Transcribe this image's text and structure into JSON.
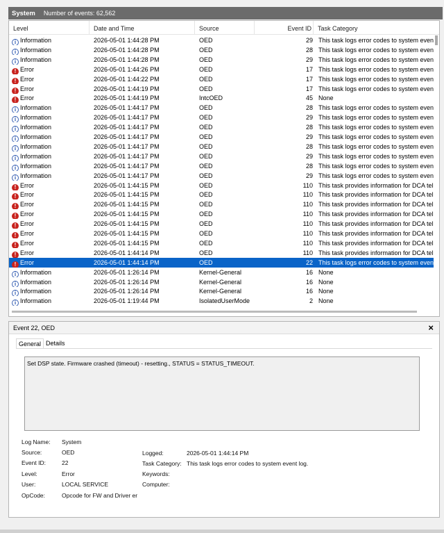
{
  "title_bar": {
    "log_name": "System",
    "event_count": "Number of events: 62,562"
  },
  "columns": {
    "level": "Level",
    "date": "Date and Time",
    "source": "Source",
    "event_id": "Event ID",
    "category": "Task Category"
  },
  "events": [
    {
      "level": "Information",
      "date": "2026-05-01 1:44:28 PM",
      "source": "OED",
      "id": "29",
      "category": "This task logs error codes to system event"
    },
    {
      "level": "Information",
      "date": "2026-05-01 1:44:28 PM",
      "source": "OED",
      "id": "28",
      "category": "This task logs error codes to system event"
    },
    {
      "level": "Information",
      "date": "2026-05-01 1:44:28 PM",
      "source": "OED",
      "id": "29",
      "category": "This task logs error codes to system event"
    },
    {
      "level": "Error",
      "date": "2026-05-01 1:44:26 PM",
      "source": "OED",
      "id": "17",
      "category": "This task logs error codes to system event"
    },
    {
      "level": "Error",
      "date": "2026-05-01 1:44:22 PM",
      "source": "OED",
      "id": "17",
      "category": "This task logs error codes to system event"
    },
    {
      "level": "Error",
      "date": "2026-05-01 1:44:19 PM",
      "source": "OED",
      "id": "17",
      "category": "This task logs error codes to system event"
    },
    {
      "level": "Error",
      "date": "2026-05-01 1:44:19 PM",
      "source": "IntcOED",
      "id": "45",
      "category": "None"
    },
    {
      "level": "Information",
      "date": "2026-05-01 1:44:17 PM",
      "source": "OED",
      "id": "28",
      "category": "This task logs error codes to system event"
    },
    {
      "level": "Information",
      "date": "2026-05-01 1:44:17 PM",
      "source": "OED",
      "id": "29",
      "category": "This task logs error codes to system event"
    },
    {
      "level": "Information",
      "date": "2026-05-01 1:44:17 PM",
      "source": "OED",
      "id": "28",
      "category": "This task logs error codes to system event"
    },
    {
      "level": "Information",
      "date": "2026-05-01 1:44:17 PM",
      "source": "OED",
      "id": "29",
      "category": "This task logs error codes to system event"
    },
    {
      "level": "Information",
      "date": "2026-05-01 1:44:17 PM",
      "source": "OED",
      "id": "28",
      "category": "This task logs error codes to system event"
    },
    {
      "level": "Information",
      "date": "2026-05-01 1:44:17 PM",
      "source": "OED",
      "id": "29",
      "category": "This task logs error codes to system event"
    },
    {
      "level": "Information",
      "date": "2026-05-01 1:44:17 PM",
      "source": "OED",
      "id": "28",
      "category": "This task logs error codes to system event"
    },
    {
      "level": "Information",
      "date": "2026-05-01 1:44:17 PM",
      "source": "OED",
      "id": "29",
      "category": "This task logs error codes to system event"
    },
    {
      "level": "Error",
      "date": "2026-05-01 1:44:15 PM",
      "source": "OED",
      "id": "110",
      "category": "This task provides information for DCA tel"
    },
    {
      "level": "Error",
      "date": "2026-05-01 1:44:15 PM",
      "source": "OED",
      "id": "110",
      "category": "This task provides information for DCA tel"
    },
    {
      "level": "Error",
      "date": "2026-05-01 1:44:15 PM",
      "source": "OED",
      "id": "110",
      "category": "This task provides information for DCA tel"
    },
    {
      "level": "Error",
      "date": "2026-05-01 1:44:15 PM",
      "source": "OED",
      "id": "110",
      "category": "This task provides information for DCA tel"
    },
    {
      "level": "Error",
      "date": "2026-05-01 1:44:15 PM",
      "source": "OED",
      "id": "110",
      "category": "This task provides information for DCA tel"
    },
    {
      "level": "Error",
      "date": "2026-05-01 1:44:15 PM",
      "source": "OED",
      "id": "110",
      "category": "This task provides information for DCA tel"
    },
    {
      "level": "Error",
      "date": "2026-05-01 1:44:15 PM",
      "source": "OED",
      "id": "110",
      "category": "This task provides information for DCA tel"
    },
    {
      "level": "Error",
      "date": "2026-05-01 1:44:14 PM",
      "source": "OED",
      "id": "110",
      "category": "This task provides information for DCA tel"
    },
    {
      "level": "Error",
      "date": "2026-05-01 1:44:14 PM",
      "source": "OED",
      "id": "22",
      "category": "This task logs error codes to system event",
      "selected": true
    },
    {
      "level": "Information",
      "date": "2026-05-01 1:26:14 PM",
      "source": "Kernel-General",
      "id": "16",
      "category": "None"
    },
    {
      "level": "Information",
      "date": "2026-05-01 1:26:14 PM",
      "source": "Kernel-General",
      "id": "16",
      "category": "None"
    },
    {
      "level": "Information",
      "date": "2026-05-01 1:26:14 PM",
      "source": "Kernel-General",
      "id": "16",
      "category": "None"
    },
    {
      "level": "Information",
      "date": "2026-05-01 1:19:44 PM",
      "source": "IsolatedUserMode",
      "id": "2",
      "category": "None"
    }
  ],
  "detail": {
    "title": "Event 22, OED",
    "close": "×",
    "tabs": [
      "General",
      "Details"
    ],
    "message": "Set DSP state. Firmware crashed (timeout) - resetting., STATUS = STATUS_TIMEOUT.",
    "labels": {
      "log_name": "Log Name:",
      "source": "Source:",
      "event_id": "Event ID:",
      "level": "Level:",
      "user": "User:",
      "opcode": "OpCode:",
      "logged": "Logged:",
      "task_category": "Task Category:",
      "keywords": "Keywords:",
      "computer": "Computer:"
    },
    "values": {
      "log_name": "System",
      "source": "OED",
      "event_id": "22",
      "level": "Error",
      "user": "LOCAL SERVICE",
      "opcode": "Opcode for FW and Driver er",
      "logged": "2026-05-01 1:44:14 PM",
      "task_category": "This task logs error codes to system event log.",
      "keywords": "",
      "computer": ""
    }
  },
  "colors": {
    "selection": "#0a64c8",
    "error_icon": "#c8231e",
    "info_icon": "#3a62b4",
    "title_bar": "#6b6b6b"
  }
}
